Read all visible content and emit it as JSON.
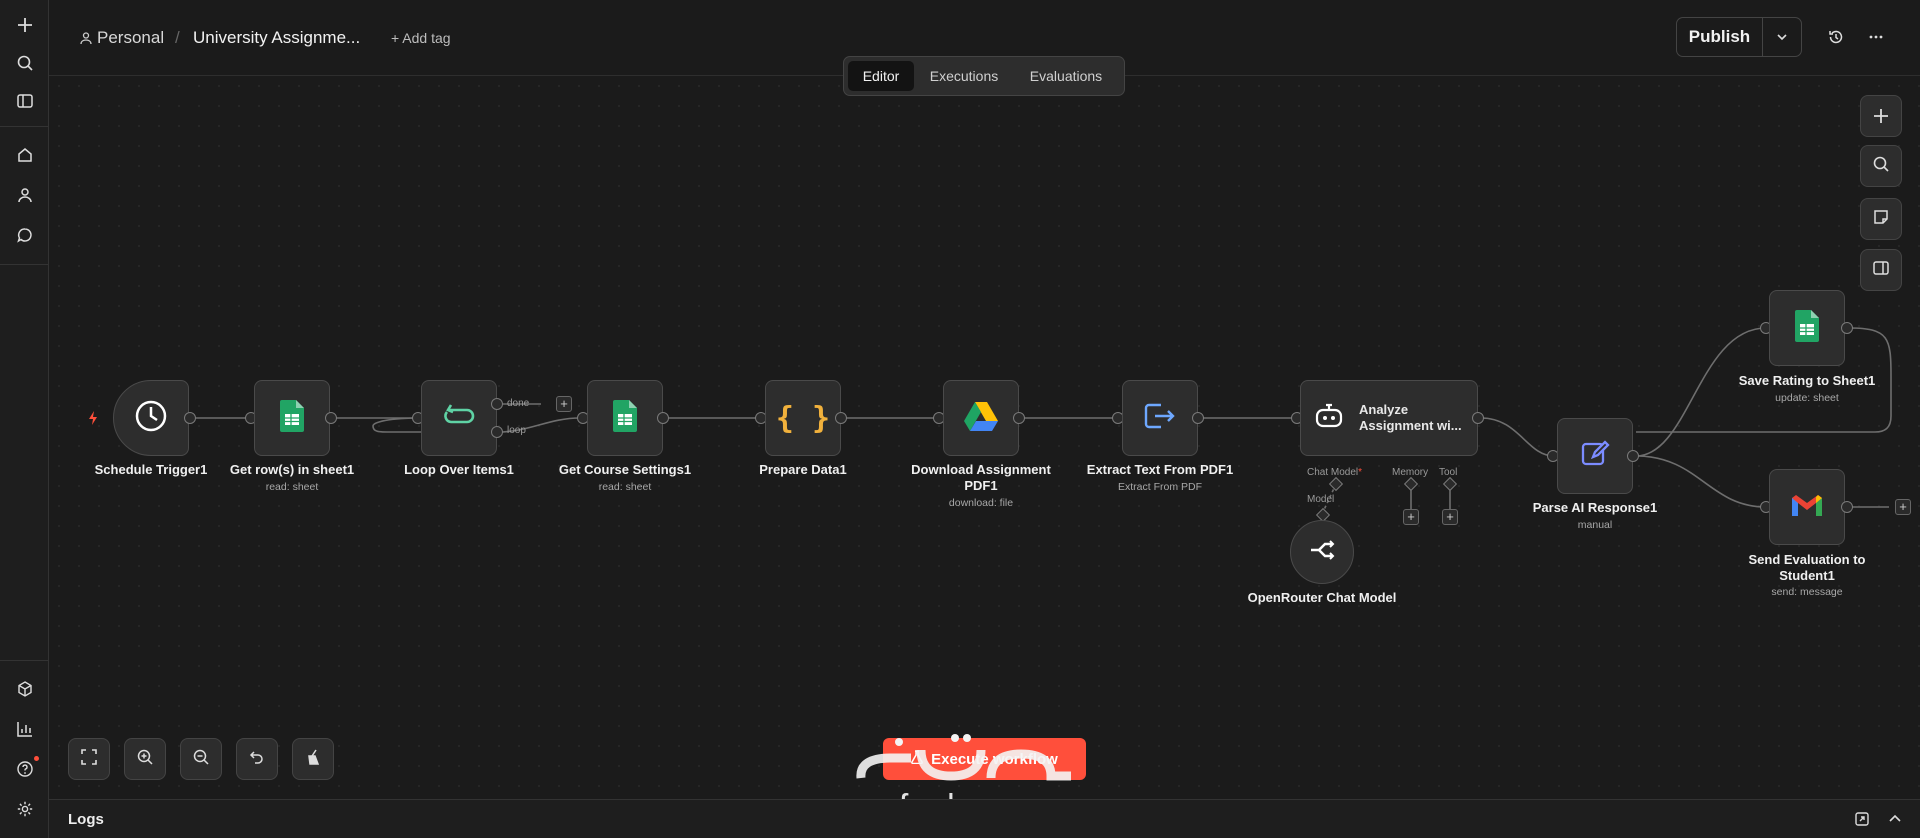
{
  "sidebar": {
    "icons": [
      "plus-icon",
      "search-icon",
      "panel-icon",
      "home-icon",
      "user-icon",
      "chat-icon",
      "cube-icon",
      "chart-icon",
      "help-icon",
      "settings-icon"
    ]
  },
  "header": {
    "workspace": "Personal",
    "separator": "/",
    "title": "University Assignme...",
    "add_tag": "+ Add tag",
    "publish": "Publish"
  },
  "tabs": [
    {
      "label": "Editor",
      "active": true
    },
    {
      "label": "Executions",
      "active": false
    },
    {
      "label": "Evaluations",
      "active": false
    }
  ],
  "nodes": [
    {
      "name": "Schedule Trigger1",
      "sub": ""
    },
    {
      "name": "Get row(s) in sheet1",
      "sub": "read: sheet"
    },
    {
      "name": "Loop Over Items1",
      "sub": ""
    },
    {
      "name": "Get Course Settings1",
      "sub": "read: sheet"
    },
    {
      "name": "Prepare Data1",
      "sub": ""
    },
    {
      "name": "Download Assignment PDF1",
      "sub": "download: file"
    },
    {
      "name": "Extract Text From PDF1",
      "sub": "Extract From PDF"
    },
    {
      "name": "Analyze Assignment wi...",
      "sub": ""
    },
    {
      "name": "Parse AI Response1",
      "sub": "manual"
    },
    {
      "name": "Save Rating to Sheet1",
      "sub": "update: sheet"
    },
    {
      "name": "Send Evaluation to Student1",
      "sub": "send: message"
    },
    {
      "name": "OpenRouter Chat Model",
      "sub": ""
    }
  ],
  "loop_labels": {
    "done": "done",
    "loop": "loop"
  },
  "agent_ports": {
    "chat_model": "Chat Model",
    "required": "*",
    "memory": "Memory",
    "tool": "Tool",
    "model": "Model"
  },
  "execute_button": "Execute workflow",
  "logs": {
    "label": "Logs"
  },
  "watermark": {
    "domain": "nafezly.com"
  },
  "colors": {
    "accent": "#ff4f3b",
    "sheets": "#21a464",
    "loop": "#5fd3a5",
    "code": "#f1b13c"
  }
}
